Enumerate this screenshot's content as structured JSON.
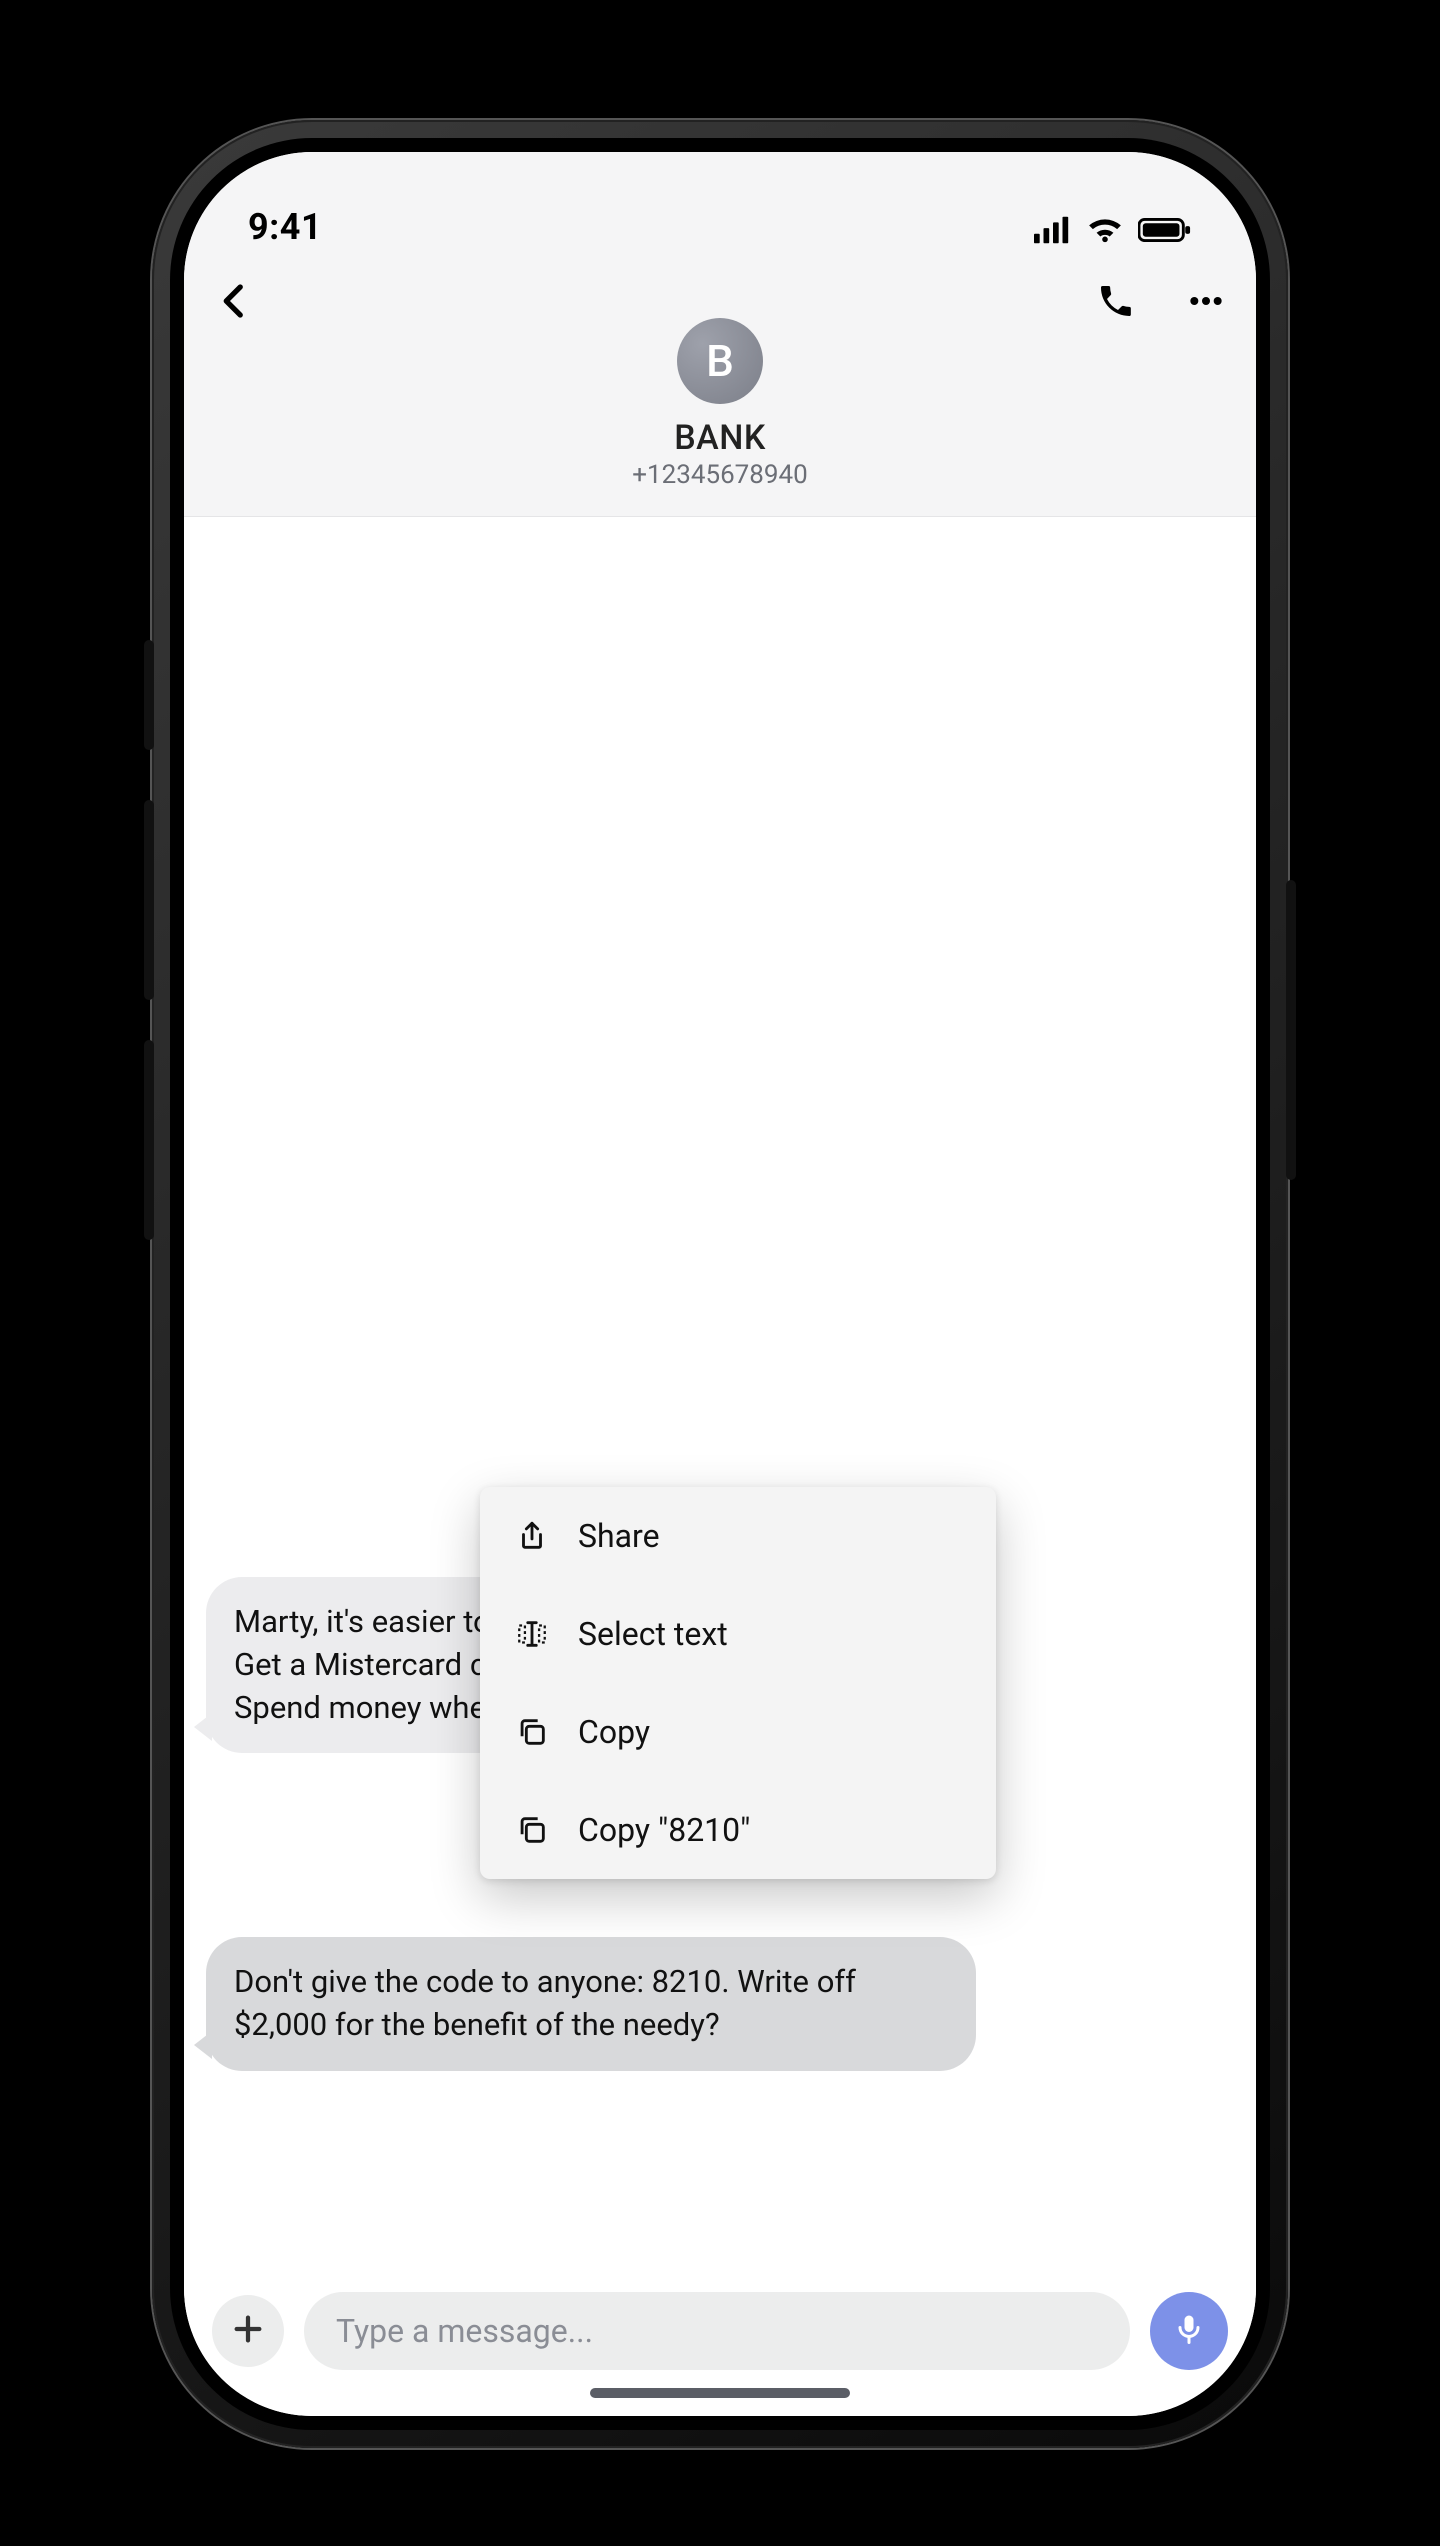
{
  "statusbar": {
    "time": "9:41"
  },
  "header": {
    "avatar_initial": "B",
    "contact_name": "BANK",
    "contact_number": "+12345678940"
  },
  "messages": {
    "m1": "Marty, it's easier to pay for purchases with a card! Get a Mistercard credit card with a limit of $5,000. Spend money wherever you want.",
    "m2": "Don't give the code to anyone: 8210. Write off $2,000 for the benefit of the needy?"
  },
  "context_menu": {
    "share": "Share",
    "select_text": "Select text",
    "copy": "Copy",
    "copy_code": "Copy \"8210\""
  },
  "composer": {
    "placeholder": "Type a message..."
  }
}
